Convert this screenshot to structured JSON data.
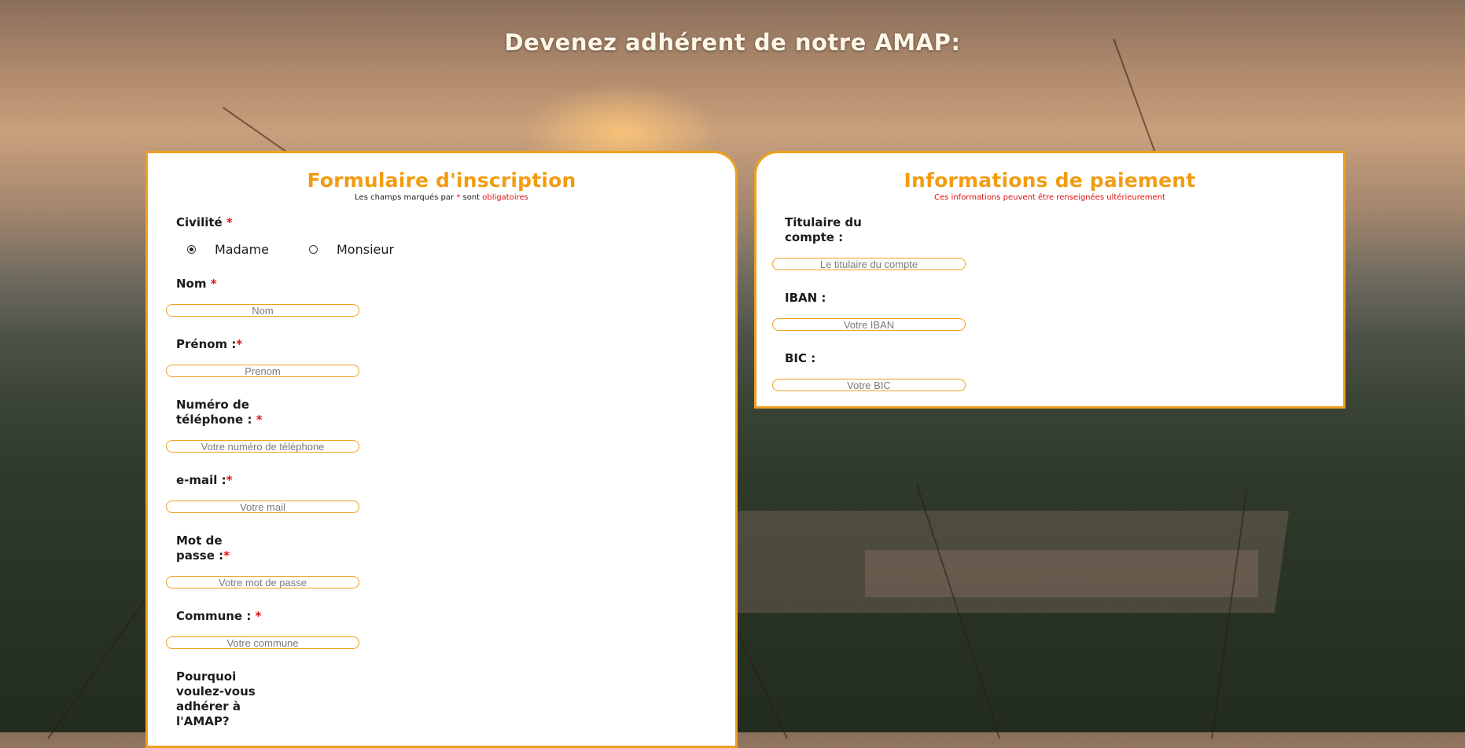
{
  "hero": {
    "title": "Devenez adhérent de notre AMAP:"
  },
  "registration": {
    "title": "Formulaire d'inscription",
    "subtitle_prefix": "Les champs marqués par ",
    "subtitle_star": "*",
    "subtitle_middle": " sont ",
    "subtitle_required": "obligatoires",
    "civility_label": "Civilité ",
    "civility_options": [
      "Madame",
      "Monsieur"
    ],
    "civility_selected": "Madame",
    "nom_label": "Nom ",
    "nom_placeholder": "Nom",
    "prenom_label": "Prénom :",
    "prenom_placeholder": "Prenom",
    "phone_label_line1": "Numéro de",
    "phone_label_line2": "téléphone : ",
    "phone_placeholder": "Votre numéro de téléphone",
    "email_label": "e-mail :",
    "email_placeholder": "Votre mail",
    "password_label_line1": "Mot de",
    "password_label_line2": "passe :",
    "password_placeholder": "Votre mot de passe",
    "commune_label": "Commune : ",
    "commune_placeholder": "Votre commune",
    "why_label_line1": "Pourquoi",
    "why_label_line2": "voulez-vous",
    "why_label_line3": "adhérer à",
    "why_label_line4": "l'AMAP?",
    "required_star": "*"
  },
  "payment": {
    "title": "Informations de paiement",
    "subtitle": "Ces informations peuvent être renseignées ultérieurement",
    "holder_label_line1": "Titulaire du",
    "holder_label_line2": "compte :",
    "holder_placeholder": "Le titulaire du compte",
    "iban_label": "IBAN :",
    "iban_placeholder": "Votre IBAN",
    "bic_label": "BIC :",
    "bic_placeholder": "Votre BIC"
  },
  "colors": {
    "accent": "#f39c12",
    "required": "#e01010"
  }
}
